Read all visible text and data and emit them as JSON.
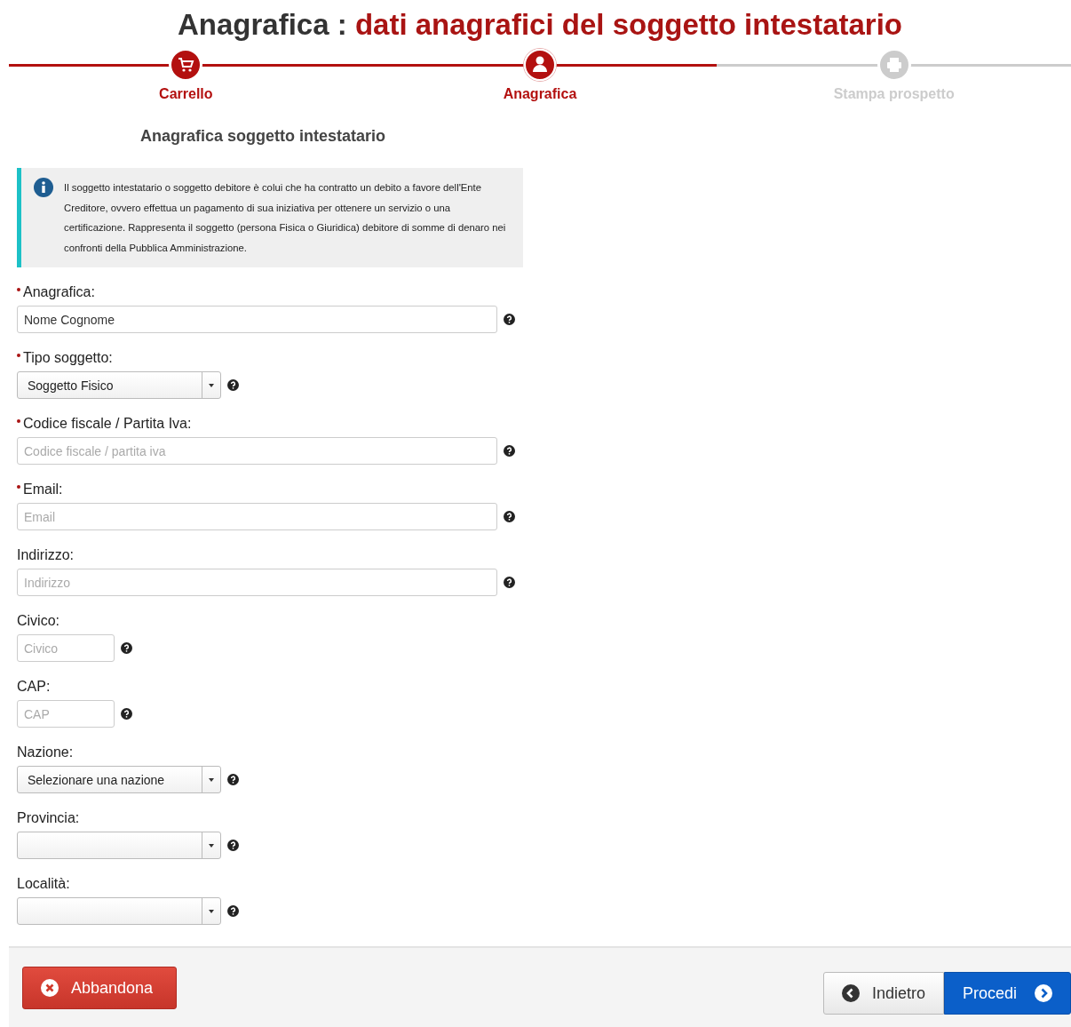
{
  "title": {
    "main": "Anagrafica :",
    "sub": "dati anagrafici del soggetto intestatario"
  },
  "steps": [
    {
      "label": "Carrello",
      "completed": true,
      "selected": false
    },
    {
      "label": "Anagrafica",
      "completed": false,
      "selected": true
    },
    {
      "label": "Stampa prospetto",
      "completed": false,
      "selected": false
    }
  ],
  "section_title": "Anagrafica soggetto intestatario",
  "info": "Il soggetto intestatario o soggetto debitore è colui che ha contratto un debito a favore dell'Ente Creditore, ovvero effettua un pagamento di sua iniziativa per ottenere un servizio o una certificazione. Rappresenta il soggetto (persona Fisica o Giuridica) debitore di somme di denaro nei confronti della Pubblica Amministrazione.",
  "fields": [
    {
      "kind": "text",
      "label": "Anagrafica:",
      "required": true,
      "value": "Nome Cognome"
    },
    {
      "kind": "select",
      "label": "Tipo soggetto:",
      "required": true,
      "value": "Soggetto Fisico"
    },
    {
      "kind": "text",
      "label": "Codice fiscale / Partita Iva:",
      "required": true,
      "placeholder": "Codice fiscale / partita iva"
    },
    {
      "kind": "text",
      "label": "Email:",
      "required": true,
      "placeholder": "Email"
    },
    {
      "kind": "text",
      "label": "Indirizzo:",
      "required": false,
      "placeholder": "Indirizzo"
    },
    {
      "kind": "short_text",
      "label": "Civico:",
      "required": false,
      "placeholder": "Civico"
    },
    {
      "kind": "short_text",
      "label": "CAP:",
      "required": false,
      "placeholder": "CAP"
    },
    {
      "kind": "select",
      "label": "Nazione:",
      "required": false,
      "value": "Selezionare una nazione"
    },
    {
      "kind": "select",
      "label": "Provincia:",
      "required": false
    },
    {
      "kind": "select",
      "label": "Località:",
      "required": false
    }
  ],
  "buttons": {
    "abandon": "Abbandona",
    "back": "Indietro",
    "next": "Procedi"
  }
}
